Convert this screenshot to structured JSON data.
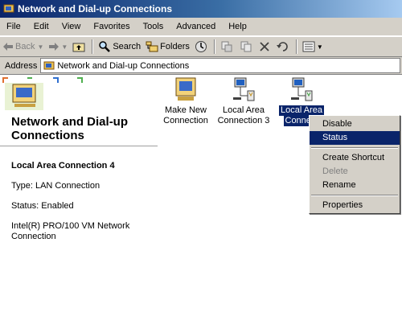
{
  "window": {
    "title": "Network and Dial-up Connections"
  },
  "menu": [
    "File",
    "Edit",
    "View",
    "Favorites",
    "Tools",
    "Advanced",
    "Help"
  ],
  "toolbar": {
    "back": "Back",
    "search": "Search",
    "folders": "Folders"
  },
  "address": {
    "label": "Address",
    "value": "Network and Dial-up Connections"
  },
  "panel": {
    "title_line1": "Network and Dial-up",
    "title_line2": "Connections",
    "selected_name": "Local Area Connection 4",
    "type": "Type: LAN Connection",
    "status": "Status: Enabled",
    "adapter_line1": "Intel(R) PRO/100 VM Network",
    "adapter_line2": "Connection"
  },
  "icons": [
    {
      "line1": "Make New",
      "line2": "Connection"
    },
    {
      "line1": "Local Area",
      "line2": "Connection 3"
    },
    {
      "line1": "Local Area",
      "line2": "Connect"
    }
  ],
  "context_menu": {
    "disable": "Disable",
    "status": "Status",
    "create_shortcut": "Create Shortcut",
    "delete": "Delete",
    "rename": "Rename",
    "properties": "Properties"
  }
}
